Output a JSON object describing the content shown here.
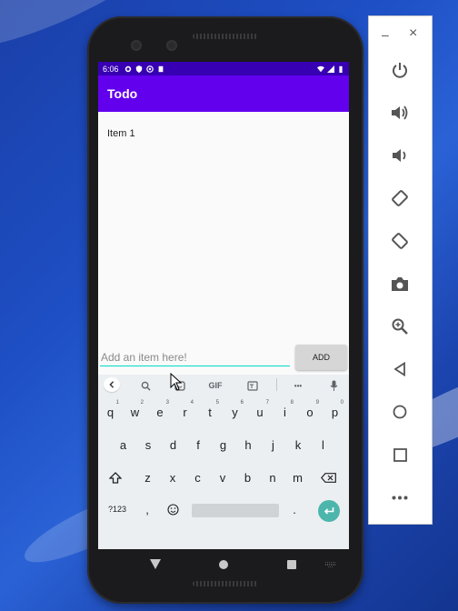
{
  "status_bar": {
    "time": "6:06"
  },
  "app_bar": {
    "title": "Todo"
  },
  "todo_list": {
    "items": [
      {
        "label": "Item 1"
      }
    ]
  },
  "input": {
    "placeholder": "Add an item here!",
    "value": ""
  },
  "add_button": {
    "label": "ADD"
  },
  "keyboard": {
    "suggestion_gif": "GIF",
    "suggestion_more": "•••",
    "row1": [
      {
        "k": "q",
        "h": "1"
      },
      {
        "k": "w",
        "h": "2"
      },
      {
        "k": "e",
        "h": "3"
      },
      {
        "k": "r",
        "h": "4"
      },
      {
        "k": "t",
        "h": "5"
      },
      {
        "k": "y",
        "h": "6"
      },
      {
        "k": "u",
        "h": "7"
      },
      {
        "k": "i",
        "h": "8"
      },
      {
        "k": "o",
        "h": "9"
      },
      {
        "k": "p",
        "h": "0"
      }
    ],
    "row2": [
      "a",
      "s",
      "d",
      "f",
      "g",
      "h",
      "j",
      "k",
      "l"
    ],
    "row3": [
      "z",
      "x",
      "c",
      "v",
      "b",
      "n",
      "m"
    ],
    "symbols_key": "?123",
    "comma_key": ",",
    "period_key": "."
  },
  "side_panel": {
    "minimize": "–",
    "close": "×"
  },
  "colors": {
    "status_bar": "#3700b3",
    "app_bar": "#6200ee",
    "accent": "#03dac5",
    "enter": "#4db6ac"
  }
}
